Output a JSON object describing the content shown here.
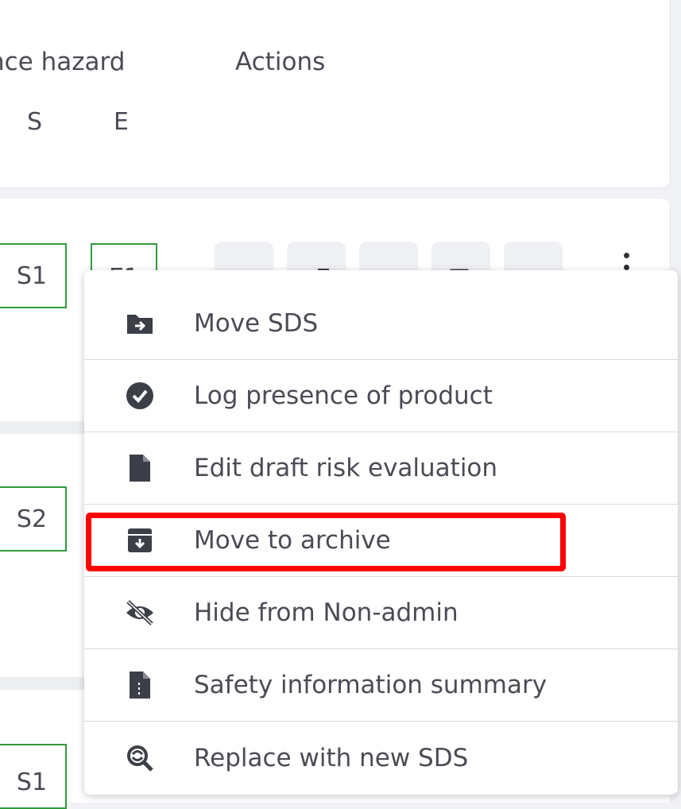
{
  "table_header": {
    "hazard_col": "nce hazard",
    "actions_col": "Actions",
    "sub_s": "S",
    "sub_e": "E"
  },
  "rows": [
    {
      "s_value": "S1",
      "e_value": "E1"
    },
    {
      "s_value": "S2"
    },
    {
      "s_value": "S1"
    }
  ],
  "row_actions": {
    "icons": [
      "pdf-icon",
      "external-link-icon",
      "tag-icon",
      "document-icon",
      "share-icon"
    ],
    "more_icon": "kebab-menu-icon"
  },
  "context_menu": {
    "items": [
      {
        "label": "Move SDS",
        "icon": "folder-move-icon"
      },
      {
        "label": "Log presence of product",
        "icon": "check-circle-icon"
      },
      {
        "label": "Edit draft risk evaluation",
        "icon": "file-icon"
      },
      {
        "label": "Move to archive",
        "icon": "archive-icon",
        "highlighted": true
      },
      {
        "label": "Hide from Non-admin",
        "icon": "eye-slash-icon"
      },
      {
        "label": "Safety information summary",
        "icon": "file-summary-icon"
      },
      {
        "label": "Replace with new SDS",
        "icon": "search-replace-icon"
      }
    ]
  },
  "colors": {
    "pill_border": "#2f9a3a",
    "highlight": "#ff0000",
    "icon": "#3d3f48"
  }
}
